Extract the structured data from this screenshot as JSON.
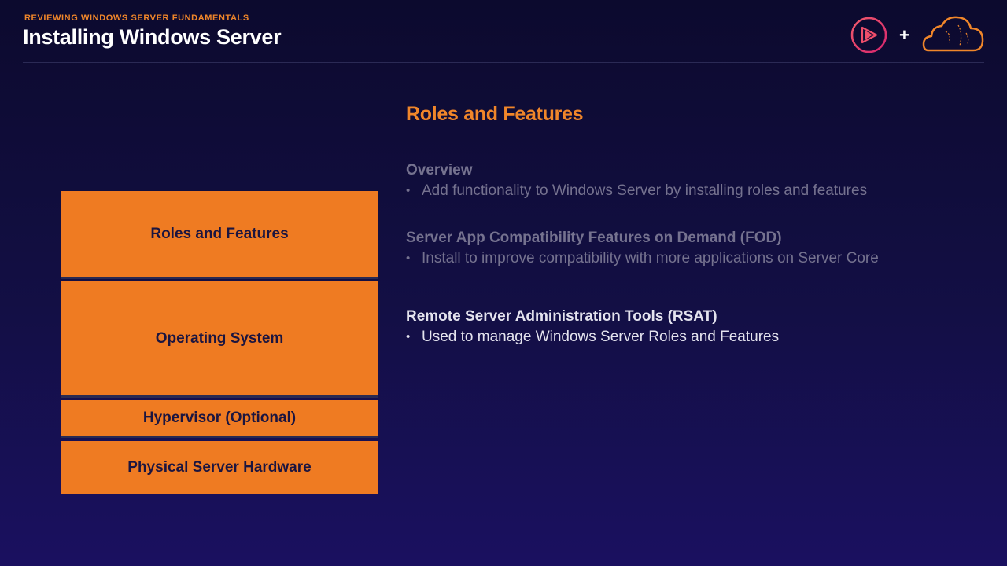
{
  "header": {
    "eyebrow": "REVIEWING WINDOWS SERVER FUNDAMENTALS",
    "title": "Installing Windows Server",
    "logo_plus": "+"
  },
  "colors": {
    "accent": "#f0862a",
    "block": "#ef7b22",
    "block_text": "#1b1540",
    "dim_text": "#75728f",
    "active_text": "#e4e3ee"
  },
  "stack": {
    "blocks": [
      {
        "label": "Roles and Features"
      },
      {
        "label": "Operating System"
      },
      {
        "label": "Hypervisor (Optional)"
      },
      {
        "label": "Physical Server Hardware"
      }
    ]
  },
  "content": {
    "section_title": "Roles and Features",
    "bullet_glyph": "•",
    "topics": [
      {
        "heading": "Overview",
        "bullet": "Add functionality to Windows Server by installing roles and features",
        "state": "dim"
      },
      {
        "heading": "Server App Compatibility Features on Demand (FOD)",
        "bullet": "Install to improve compatibility with more applications on Server Core",
        "state": "dim"
      },
      {
        "heading": "Remote Server Administration Tools (RSAT)",
        "bullet": "Used to manage Windows Server Roles and Features",
        "state": "active"
      }
    ]
  },
  "icons": [
    "play-logo-icon",
    "cloud-logo-icon"
  ]
}
